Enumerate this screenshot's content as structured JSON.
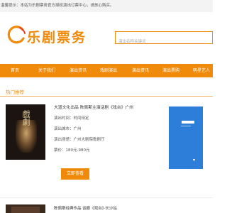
{
  "notice": "温馨提示：本站为乐剧票务官方授权演出订票中心，请放心购买。",
  "logo": {
    "text": "乐剧票务"
  },
  "search": {
    "placeholder": "演出名称关键词"
  },
  "nav": {
    "items": [
      {
        "label": "首页"
      },
      {
        "label": "关于我们"
      },
      {
        "label": "演出资讯"
      },
      {
        "label": "戏剧演出"
      },
      {
        "label": "演出资讯"
      },
      {
        "label": "演出票购"
      },
      {
        "label": "明星艺人"
      }
    ]
  },
  "section": {
    "title": "热门推荐"
  },
  "show1": {
    "poster_text": "戲劇",
    "title": "大道文化出品 陈佩斯主演话剧《戏台》广州",
    "time_label": "演出时间：时间待定",
    "city_label": "演出城市：广州",
    "venue_label": "演出场馆：广州大剧院歌剧厅",
    "price_label": "票价：180元-980元",
    "buy_label": "立即查看"
  },
  "show2": {
    "title": "陈佩斯经典作品 话剧《戏台》·长沙站"
  },
  "colors": {
    "accent": "#f08a0a",
    "qr_bg": "#2d7ed9"
  }
}
